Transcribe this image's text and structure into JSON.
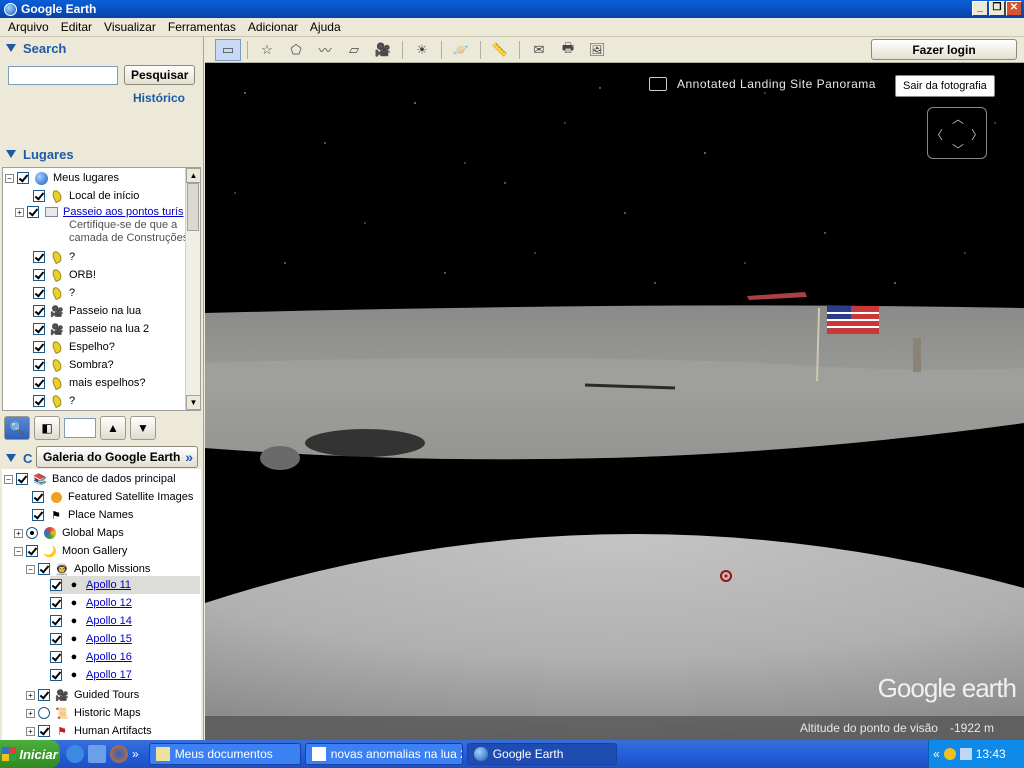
{
  "window": {
    "title": "Google Earth",
    "controls": [
      "_",
      "❐",
      "✕"
    ]
  },
  "menu": [
    "Arquivo",
    "Editar",
    "Visualizar",
    "Ferramentas",
    "Adicionar",
    "Ajuda"
  ],
  "search": {
    "heading": "Search",
    "button": "Pesquisar",
    "history": "Histórico",
    "value": ""
  },
  "places": {
    "heading": "Lugares",
    "items": [
      {
        "label": "Meus lugares"
      },
      {
        "label": "Local de início"
      },
      {
        "label": "Passeio aos pontos turís",
        "desc1": "Certifique-se de que a",
        "desc2": "camada de Construções"
      },
      {
        "label": "?"
      },
      {
        "label": "ORB!"
      },
      {
        "label": "?"
      },
      {
        "label": "Passeio na lua"
      },
      {
        "label": "passeio na lua 2"
      },
      {
        "label": "Espelho?"
      },
      {
        "label": "Sombra?"
      },
      {
        "label": "mais espelhos?"
      },
      {
        "label": "?"
      }
    ]
  },
  "layers": {
    "gallery_button": "Galeria do Google Earth",
    "items": [
      {
        "label": "Banco de dados principal"
      },
      {
        "label": "Featured Satellite Images"
      },
      {
        "label": "Place Names"
      },
      {
        "label": "Global Maps"
      },
      {
        "label": "Moon Gallery"
      },
      {
        "label": "Apollo Missions"
      },
      {
        "label": "Apollo 11"
      },
      {
        "label": "Apollo 12"
      },
      {
        "label": "Apollo 14"
      },
      {
        "label": "Apollo 15"
      },
      {
        "label": "Apollo 16"
      },
      {
        "label": "Apollo 17"
      },
      {
        "label": "Guided Tours"
      },
      {
        "label": "Historic Maps"
      },
      {
        "label": "Human Artifacts"
      }
    ]
  },
  "toolbar": {
    "login": "Fazer login"
  },
  "view": {
    "photo_title": "Annotated Landing Site Panorama",
    "exit_photo": "Sair da fotografia",
    "brand": "Google earth",
    "altitude_label": "Altitude do ponto de visão",
    "altitude_value": "-1922 m"
  },
  "taskbar": {
    "start": "Iniciar",
    "tasks": [
      "Meus documentos",
      "novas anomalias na lua 2...",
      "Google Earth"
    ],
    "clock": "13:43"
  }
}
